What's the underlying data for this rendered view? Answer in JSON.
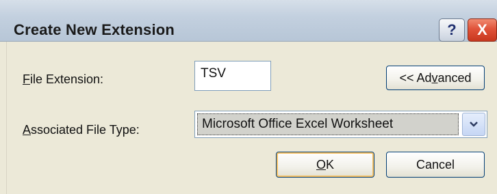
{
  "window": {
    "title": "Create New Extension",
    "help_button": "?",
    "close_button": "X"
  },
  "form": {
    "extension_label_mnemonic": "F",
    "extension_label_rest": "ile Extension:",
    "extension_value": "TSV",
    "type_label_mnemonic": "A",
    "type_label_rest": "ssociated File Type:",
    "type_selected": "Microsoft Office Excel Worksheet"
  },
  "buttons": {
    "advanced_pre": "<< Ad",
    "advanced_mnemonic": "v",
    "advanced_post": "anced",
    "ok_mnemonic": "O",
    "ok_rest": "K",
    "cancel": "Cancel"
  },
  "icons": {
    "help": "question-mark-icon",
    "close": "close-icon",
    "dropdown": "chevron-down-icon"
  },
  "colors": {
    "dialog_bg": "#ece9d8",
    "close_red": "#e0533a",
    "ok_focus": "#f5c063",
    "selection_gray": "#d2d2cc"
  }
}
